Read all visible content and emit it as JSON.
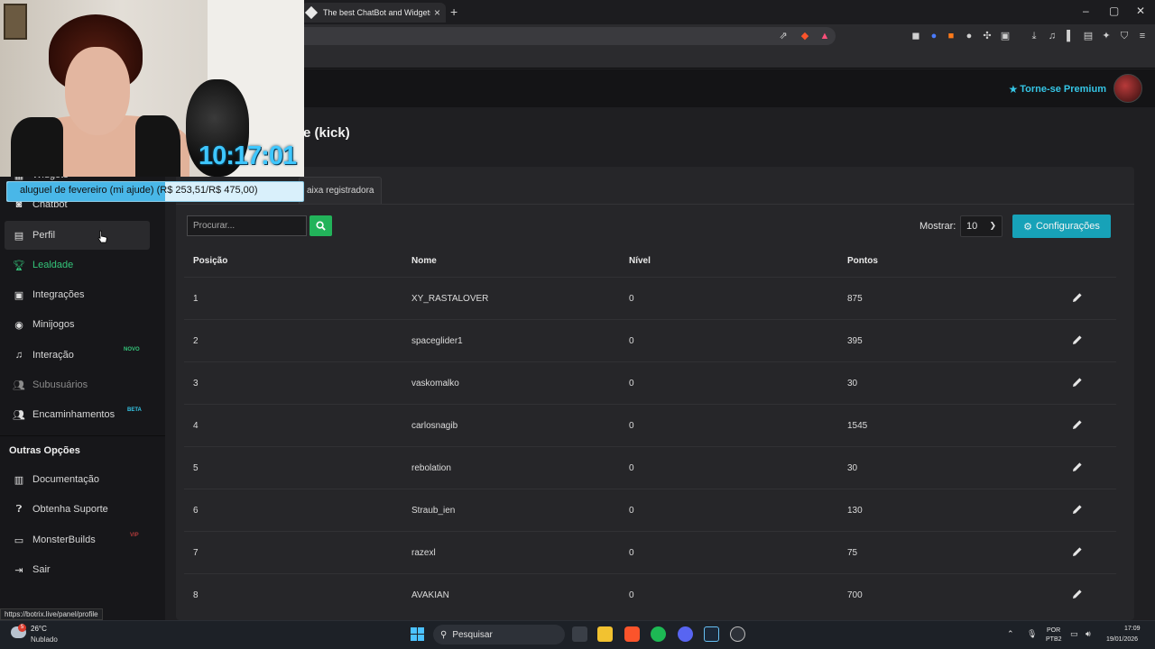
{
  "browser": {
    "tab_title": "The best ChatBot and Widgets f",
    "new_tab": "+",
    "tab_close": "×",
    "window_controls": [
      "–",
      "▢",
      "✕"
    ]
  },
  "header": {
    "premium_label": "Torne-se Premium"
  },
  "page": {
    "title_partial": "e (kick)",
    "tab_register": "aixa registradora"
  },
  "sidebar": {
    "items": [
      {
        "label": "Widgets",
        "icon": "grid-icon"
      },
      {
        "label": "Chatbot",
        "icon": "robot-icon"
      },
      {
        "label": "Perfil",
        "icon": "id-card-icon"
      },
      {
        "label": "Lealdade",
        "icon": "trophy-icon"
      },
      {
        "label": "Integrações",
        "icon": "plug-icon"
      },
      {
        "label": "Minijogos",
        "icon": "gamepad-icon"
      },
      {
        "label": "Interação",
        "icon": "music-icon",
        "badge": "NOVO"
      },
      {
        "label": "Subusuários",
        "icon": "users-icon"
      },
      {
        "label": "Encaminhamentos",
        "icon": "users-icon",
        "badge": "BETA"
      }
    ],
    "section_title": "Outras Opções",
    "other_items": [
      {
        "label": "Documentação",
        "icon": "book-icon"
      },
      {
        "label": "Obtenha Suporte",
        "icon": "question-icon"
      },
      {
        "label": "MonsterBuilds",
        "icon": "laptop-icon",
        "badge": "VIP"
      },
      {
        "label": "Sair",
        "icon": "logout-icon"
      }
    ]
  },
  "toolbar": {
    "search_placeholder": "Procurar...",
    "show_label": "Mostrar:",
    "show_value": "10",
    "config_label": "Configurações"
  },
  "table": {
    "columns": [
      "Posição",
      "Nome",
      "Nível",
      "Pontos"
    ],
    "rows": [
      {
        "pos": "1",
        "name": "XY_RASTALOVER",
        "level": "0",
        "points": "875"
      },
      {
        "pos": "2",
        "name": "spaceglider1",
        "level": "0",
        "points": "395"
      },
      {
        "pos": "3",
        "name": "vaskomalko",
        "level": "0",
        "points": "30"
      },
      {
        "pos": "4",
        "name": "carlosnagib",
        "level": "0",
        "points": "1545"
      },
      {
        "pos": "5",
        "name": "rebolation",
        "level": "0",
        "points": "30"
      },
      {
        "pos": "6",
        "name": "Straub_ien",
        "level": "0",
        "points": "130"
      },
      {
        "pos": "7",
        "name": "razexl",
        "level": "0",
        "points": "75"
      },
      {
        "pos": "8",
        "name": "AVAKIAN",
        "level": "0",
        "points": "700"
      }
    ]
  },
  "overlay": {
    "clock": "10:17:01",
    "goal_text": "aluguel de fevereiro (mi ajude) (R$ 253,51/R$ 475,00)",
    "goal_progress": 0.534
  },
  "status_url": "https://botrix.live/panel/profile",
  "taskbar": {
    "temperature": "26°C",
    "condition": "Nublado",
    "weather_badge": "5",
    "search_label": "Pesquisar",
    "lang": "POR",
    "layout": "PTB2",
    "time": "17:09",
    "date": "19/01/2026"
  },
  "colors": {
    "accent_teal": "#17a2b8",
    "accent_green": "#22b35a",
    "premium_blue": "#35c6e6",
    "clock_blue": "#3ec7ff"
  }
}
